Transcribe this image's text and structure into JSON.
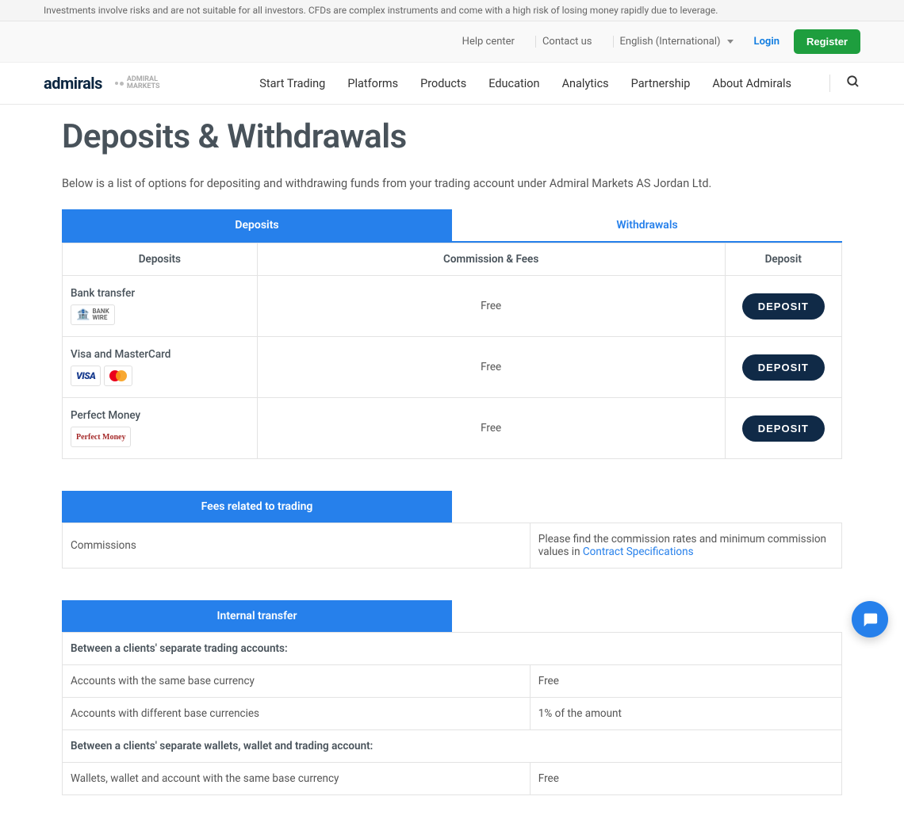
{
  "risk_warning": "Investments involve risks and are not suitable for all investors. CFDs are complex instruments and come with a high risk of losing money rapidly due to leverage.",
  "top_bar": {
    "help_center": "Help center",
    "contact_us": "Contact us",
    "language": "English (International)",
    "login": "Login",
    "register": "Register"
  },
  "brand": {
    "name": "admirals",
    "sub_brand_line1": "ADMIRAL",
    "sub_brand_line2": "MARKETS"
  },
  "nav": {
    "items": [
      "Start Trading",
      "Platforms",
      "Products",
      "Education",
      "Analytics",
      "Partnership",
      "About Admirals"
    ]
  },
  "page": {
    "title": "Deposits & Withdrawals",
    "intro": "Below is a list of options for depositing and withdrawing funds from your trading account under Admiral Markets AS Jordan Ltd."
  },
  "tabs": {
    "deposits": "Deposits",
    "withdrawals": "Withdrawals"
  },
  "table_headers": {
    "deposits": "Deposits",
    "commission": "Commission & Fees",
    "deposit": "Deposit"
  },
  "methods": [
    {
      "name": "Bank transfer",
      "fee": "Free",
      "action": "DEPOSIT",
      "icon_type": "bank",
      "icon_label1": "BANK",
      "icon_label2": "WIRE"
    },
    {
      "name": "Visa and MasterCard",
      "fee": "Free",
      "action": "DEPOSIT",
      "icon_type": "visa_mc",
      "icon_label1": "VISA"
    },
    {
      "name": "Perfect Money",
      "fee": "Free",
      "action": "DEPOSIT",
      "icon_type": "perfect_money",
      "icon_label1": "Perfect Money"
    }
  ],
  "fees_section": {
    "header": "Fees related to trading",
    "commissions_label": "Commissions",
    "commissions_text": "Please find the commission rates and minimum commission values in ",
    "commissions_link": "Contract Specifications"
  },
  "internal_transfer": {
    "header": "Internal transfer",
    "rows": [
      {
        "label": "Between a clients' separate trading accounts:",
        "value": "",
        "bold": true
      },
      {
        "label": "Accounts with the same base currency",
        "value": "Free",
        "bold": false
      },
      {
        "label": "Accounts with different base currencies",
        "value": "1% of the amount",
        "bold": false
      },
      {
        "label": "Between a clients' separate wallets, wallet and trading account:",
        "value": "",
        "bold": true
      },
      {
        "label": "Wallets, wallet and account with the same base currency",
        "value": "Free",
        "bold": false
      }
    ]
  }
}
